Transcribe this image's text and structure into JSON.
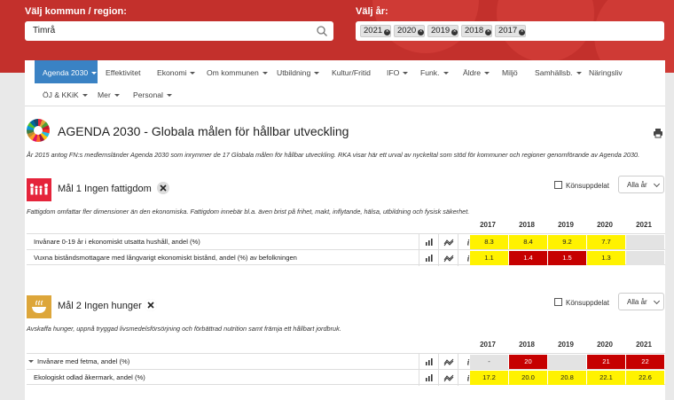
{
  "header": {
    "kommun_label": "Välj kommun / region:",
    "kommun_value": "Timrå",
    "year_label": "Välj år:",
    "year_tags": [
      "2021",
      "2020",
      "2019",
      "2018",
      "2017"
    ]
  },
  "nav": {
    "items": [
      {
        "label": "Agenda 2030",
        "dropdown": true,
        "active": true
      },
      {
        "label": "Effektivitet",
        "dropdown": false
      },
      {
        "label": "Ekonomi",
        "dropdown": true
      },
      {
        "label": "Om kommunen",
        "dropdown": true
      },
      {
        "label": "Utbildning",
        "dropdown": true
      },
      {
        "label": "Kultur/Fritid",
        "dropdown": false
      },
      {
        "label": "IFO",
        "dropdown": true
      },
      {
        "label": "Funk.",
        "dropdown": true
      },
      {
        "label": "Äldre",
        "dropdown": true
      },
      {
        "label": "Miljö",
        "dropdown": false
      },
      {
        "label": "Samhällsb.",
        "dropdown": true
      },
      {
        "label": "Näringsliv",
        "dropdown": false
      },
      {
        "label": "ÖJ & KKiK",
        "dropdown": true
      },
      {
        "label": "Mer",
        "dropdown": true
      },
      {
        "label": "Personal",
        "dropdown": true
      }
    ]
  },
  "page": {
    "title": "AGENDA 2030 - Globala målen för hållbar utveckling",
    "intro": "År 2015 antog FN:s medlemsländer Agenda 2030 som inrymmer de 17 Globala målen för hållbar utveckling. RKA visar här ett urval av nyckeltal som stöd för kommuner och regioner genomförande av Agenda 2030."
  },
  "goals": [
    {
      "title": "Mål 1 Ingen fattigdom",
      "icon_color": "#e5243b",
      "gender_label": "Könsuppdelat",
      "select_value": "Alla år",
      "description": "Fattigdom omfattar fler dimensioner än den ekonomiska. Fattigdom innebär bl.a. även brist på frihet, makt, inflytande, hälsa, utbildning och fysisk säkerhet.",
      "years": [
        "2017",
        "2018",
        "2019",
        "2020",
        "2021"
      ],
      "rows": [
        {
          "label": "Invånare 0-19 år i ekonomiskt utsatta hushåll, andel (%)",
          "values": [
            "8.3",
            "8.4",
            "9.2",
            "7.7",
            ""
          ],
          "colors": [
            "yellow",
            "yellow",
            "yellow",
            "yellow",
            "grey"
          ]
        },
        {
          "label": "Vuxna biståndsmottagare med långvarigt ekonomiskt bistånd, andel (%) av befolkningen",
          "values": [
            "1.1",
            "1.4",
            "1.5",
            "1.3",
            ""
          ],
          "colors": [
            "yellow",
            "red",
            "red",
            "yellow",
            "grey"
          ]
        }
      ]
    },
    {
      "title": "Mål 2 Ingen hunger",
      "icon_color": "#dda63a",
      "gender_label": "Könsuppdelat",
      "select_value": "Alla år",
      "description": "Avskaffa hunger, uppnå tryggad livsmedelsförsörjning och förbättrad nutrition samt främja ett hållbart jordbruk.",
      "years": [
        "2017",
        "2018",
        "2019",
        "2020",
        "2021"
      ],
      "rows": [
        {
          "label": "Invånare med fetma, andel (%)",
          "values": [
            "-",
            "20",
            "",
            "21",
            "22"
          ],
          "colors": [
            "grey",
            "red",
            "grey",
            "red",
            "red"
          ]
        },
        {
          "label": "Ekologiskt odlad åkermark, andel (%)",
          "values": [
            "17.2",
            "20.0",
            "20.8",
            "22.1",
            "22.6"
          ],
          "colors": [
            "yellow",
            "yellow",
            "yellow",
            "yellow",
            "yellow"
          ]
        }
      ]
    }
  ]
}
